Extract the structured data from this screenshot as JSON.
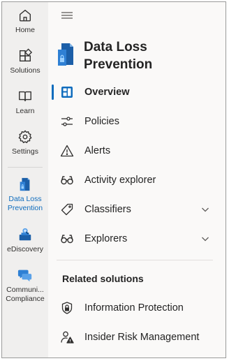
{
  "rail": {
    "items": [
      {
        "label": "Home",
        "icon": "home-icon"
      },
      {
        "label": "Solutions",
        "icon": "solutions-icon"
      },
      {
        "label": "Learn",
        "icon": "book-icon"
      },
      {
        "label": "Settings",
        "icon": "gear-icon"
      },
      {
        "label": "Data Loss Prevention",
        "icon": "dlp-icon",
        "active": true
      },
      {
        "label": "eDiscovery",
        "icon": "ediscovery-icon"
      },
      {
        "label": "Communi... Compliance",
        "icon": "communication-icon"
      }
    ]
  },
  "header": {
    "title": "Data Loss Prevention"
  },
  "nav": {
    "items": [
      {
        "label": "Overview",
        "icon": "overview-icon",
        "active": true
      },
      {
        "label": "Policies",
        "icon": "sliders-icon"
      },
      {
        "label": "Alerts",
        "icon": "warning-icon"
      },
      {
        "label": "Activity explorer",
        "icon": "glasses-icon"
      },
      {
        "label": "Classifiers",
        "icon": "tag-icon",
        "expandable": true
      },
      {
        "label": "Explorers",
        "icon": "glasses-icon",
        "expandable": true
      }
    ]
  },
  "related": {
    "title": "Related solutions",
    "items": [
      {
        "label": "Information Protection",
        "icon": "lock-shield-icon"
      },
      {
        "label": "Insider Risk Management",
        "icon": "user-warning-icon"
      }
    ]
  },
  "colors": {
    "accent": "#0f6cbd",
    "rail_bg": "#f0efee",
    "nav_bg": "#faf9f8"
  }
}
